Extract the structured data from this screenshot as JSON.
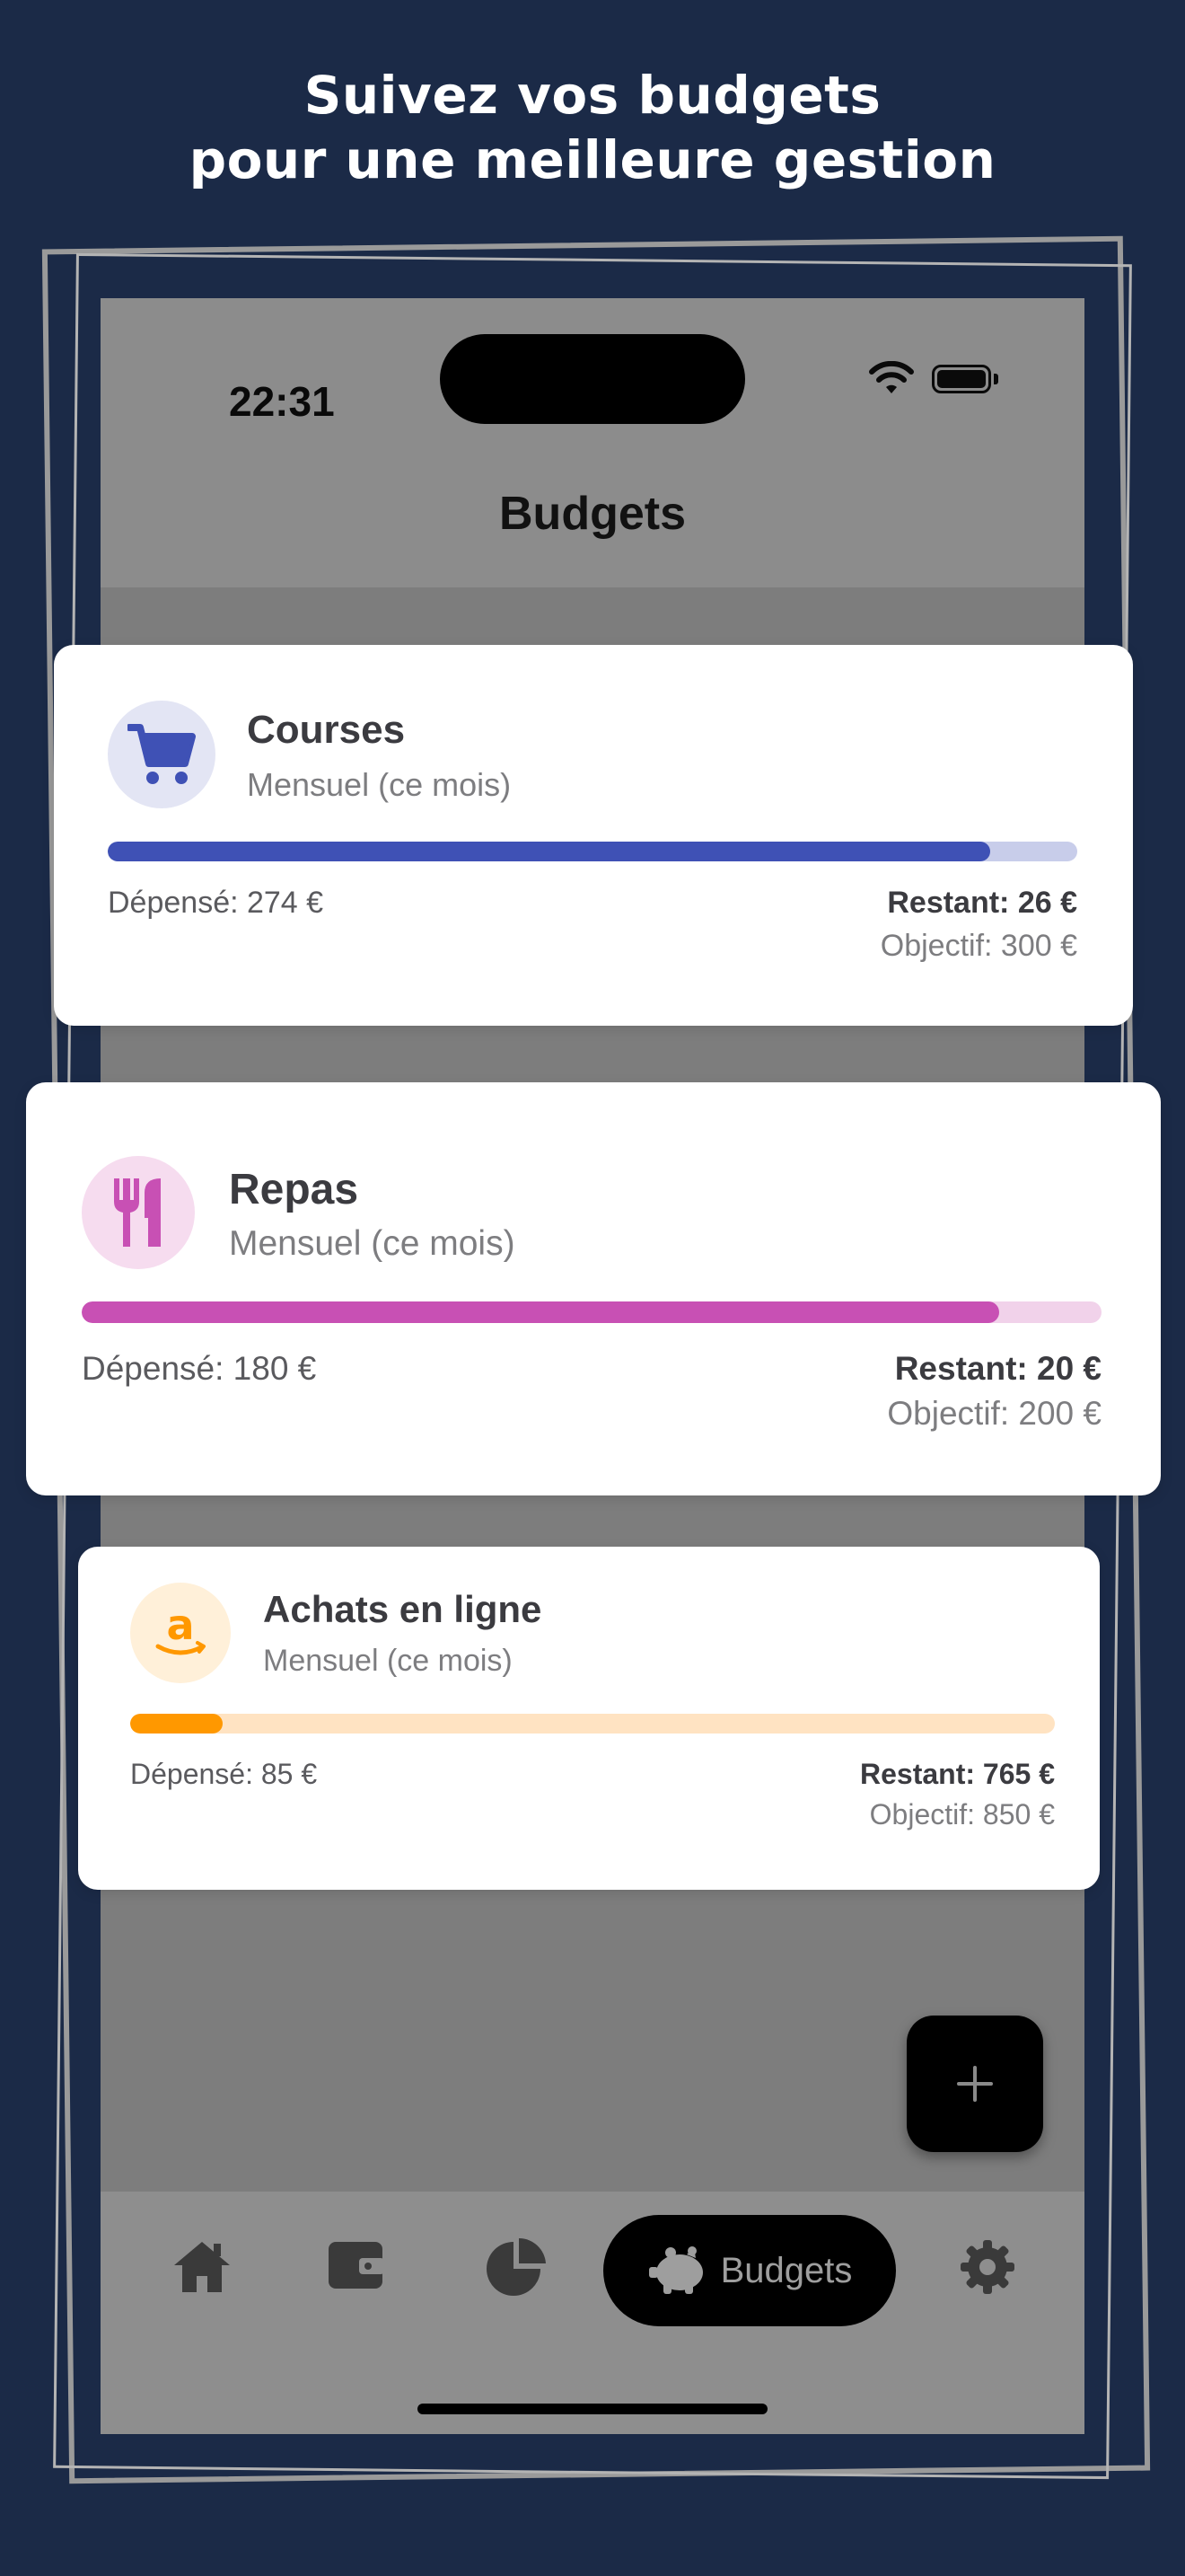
{
  "headline": {
    "line1": "Suivez vos budgets",
    "line2": "pour une meilleure gestion"
  },
  "status_bar": {
    "time": "22:31"
  },
  "app_bar": {
    "title": "Budgets"
  },
  "budgets": [
    {
      "name": "Courses",
      "period": "Mensuel (ce mois)",
      "spent": "Dépensé: 274 €",
      "remaining": "Restant: 26 €",
      "goal": "Objectif: 300 €",
      "progress": 0.91,
      "icon": "shopping-cart-icon",
      "color": "#3f51b5",
      "track_color": "#c8cdea",
      "icon_bg": "#e3e5f4"
    },
    {
      "name": "Repas",
      "period": "Mensuel (ce mois)",
      "spent": "Dépensé: 180 €",
      "remaining": "Restant: 20 €",
      "goal": "Objectif: 200 €",
      "progress": 0.9,
      "icon": "restaurant-icon",
      "color": "#c850b4",
      "track_color": "#f1d2ea",
      "icon_bg": "#f6dcef"
    },
    {
      "name": "Achats en ligne",
      "period": "Mensuel (ce mois)",
      "spent": "Dépensé: 85 €",
      "remaining": "Restant: 765 €",
      "goal": "Objectif: 850 €",
      "progress": 0.1,
      "icon": "amazon-icon",
      "color": "#ff9800",
      "track_color": "#ffe3c2",
      "icon_bg": "#fff0d9"
    }
  ],
  "fab": {
    "icon": "plus-icon"
  },
  "bottom_nav": {
    "items": [
      {
        "icon": "home-icon"
      },
      {
        "icon": "wallet-icon"
      },
      {
        "icon": "pie-chart-icon"
      },
      {
        "icon": "piggy-bank-icon",
        "label": "Budgets",
        "active": true
      },
      {
        "icon": "gear-icon"
      }
    ]
  }
}
